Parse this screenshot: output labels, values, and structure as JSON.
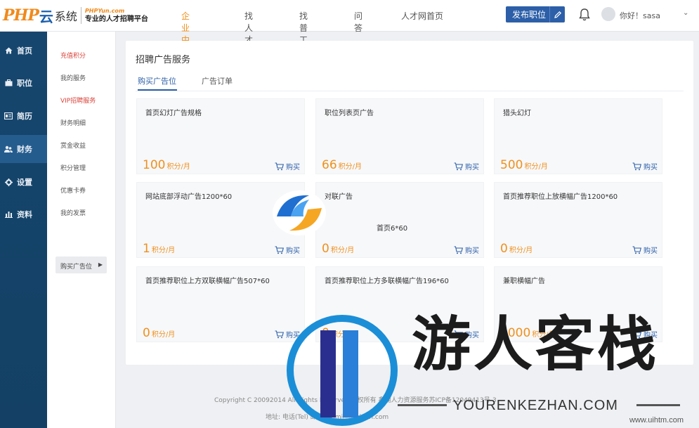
{
  "brand": {
    "php": "PHP",
    "cloud": "云",
    "system": "系统",
    "domain": "PHPYun.com",
    "tagline": "专业的人才招聘平台"
  },
  "topnav": {
    "items": [
      "企业中心",
      "找人才",
      "找普工",
      "问答",
      "人才网首页"
    ],
    "active_index": 0
  },
  "header": {
    "publish_label": "发布职位",
    "greeting": "你好！sasa"
  },
  "sidebar": {
    "items": [
      "首页",
      "职位",
      "简历",
      "财务",
      "设置",
      "资料"
    ],
    "active_index": 3
  },
  "submenu": {
    "items": [
      "充值积分",
      "我的服务",
      "VIP招聘服务",
      "财务明细",
      "赏金收益",
      "积分管理",
      "优惠卡券",
      "我的发票"
    ],
    "red_indices": [
      0,
      2
    ],
    "active_label": "购买广告位"
  },
  "panel": {
    "title": "招聘广告服务",
    "tabs": [
      "购买广告位",
      "广告订单"
    ],
    "active_tab": 0,
    "buy_label": "购买",
    "cards": [
      {
        "title": "首页幻灯广告规格",
        "price": "100",
        "unit": "积分/月"
      },
      {
        "title": "职位列表页广告",
        "price": "66",
        "unit": "积分/月"
      },
      {
        "title": "猎头幻灯",
        "price": "500",
        "unit": "积分/月"
      },
      {
        "title": "网站底部浮动广告1200*60",
        "price": "1",
        "unit": "积分/月"
      },
      {
        "title": "对联广告",
        "price": "0",
        "unit": "积分/月"
      },
      {
        "title": "首页推荐职位上放横幅广告1200*60",
        "price": "0",
        "unit": "积分/月"
      },
      {
        "title": "首页推荐职位上方双联横幅广告507*60",
        "price": "0",
        "unit": "积分/月"
      },
      {
        "title": "首页推荐职位上方多联横幅广告196*60",
        "price": "0",
        "unit": "积分/月"
      },
      {
        "title": "兼职横幅广告",
        "price": "1000",
        "unit": "积分/月"
      }
    ]
  },
  "footer": {
    "copyright": "Copyright C 20092014 All Rights Reserved 版权所有 鑫潮人力资源服务苏ICP备12049413号-3",
    "address": "地址: 电话(Tel) 邮箱: admin@admin.com"
  },
  "watermark": {
    "float_text": "首页6*60",
    "chinese": "游人客栈",
    "english": "YOURENKEZHAN.COM",
    "url": "www.uihtm.com"
  },
  "colors": {
    "accent_orange": "#f0901c",
    "primary_blue": "#2c5fa8",
    "sidebar_dark": "#16466e",
    "red_link": "#d9443b"
  }
}
